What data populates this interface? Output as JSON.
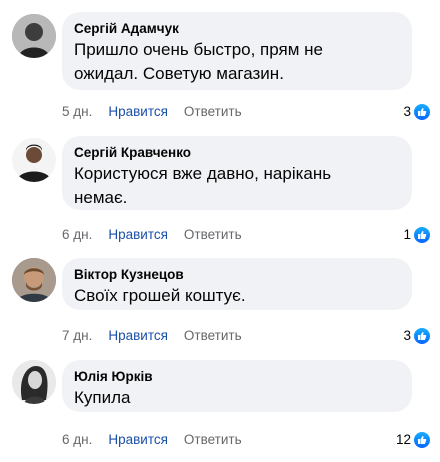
{
  "colors": {
    "bubble": "#f0f2f5",
    "like_link": "#1b4fa8",
    "meta": "#65676b",
    "like_badge": "#0866ff"
  },
  "comments": [
    {
      "author": "Сергій Адамчук",
      "text_lines": [
        "Пришло очень быстро, прям не",
        "ожидал. Советую магазин."
      ],
      "time": "5 дн.",
      "like_label": "Нравится",
      "reply_label": "Ответить",
      "reactions": "3",
      "reaction_icon": "like-thumb-icon"
    },
    {
      "author": "Сергій Кравченко",
      "text_lines": [
        "Користуюся вже давно, нарікань",
        "немає."
      ],
      "time": "6 дн.",
      "like_label": "Нравится",
      "reply_label": "Ответить",
      "reactions": "1",
      "reaction_icon": "like-thumb-icon"
    },
    {
      "author": "Віктор Кузнецов",
      "text_lines": [
        "Своїх грошей коштує."
      ],
      "time": "7 дн.",
      "like_label": "Нравится",
      "reply_label": "Ответить",
      "reactions": "3",
      "reaction_icon": "like-thumb-icon"
    },
    {
      "author": "Юлія Юрків",
      "text_lines": [
        "Купила"
      ],
      "time": "6 дн.",
      "like_label": "Нравится",
      "reply_label": "Ответить",
      "reactions": "12",
      "reaction_icon": "like-thumb-icon"
    }
  ]
}
